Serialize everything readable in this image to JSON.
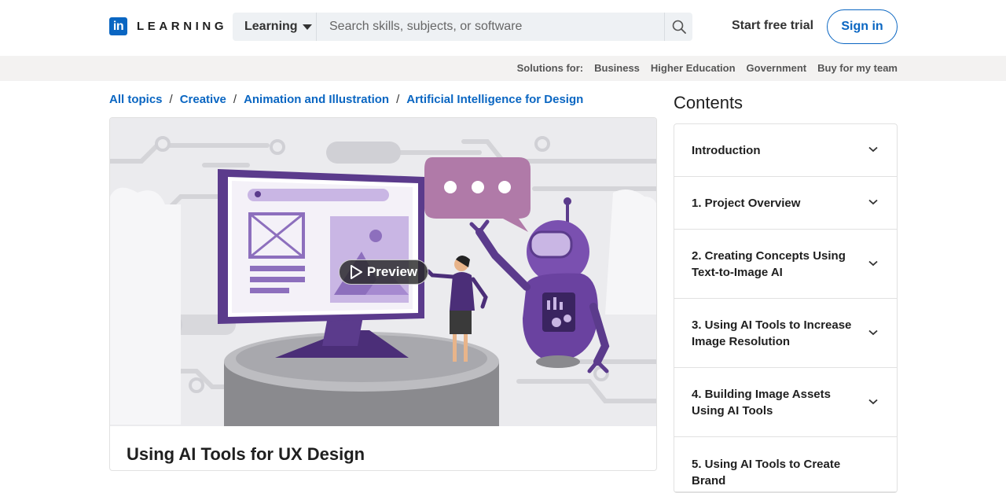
{
  "header": {
    "logo_in": "in",
    "logo_text": "LEARNING",
    "search_scope": "Learning",
    "search_placeholder": "Search skills, subjects, or software",
    "start_trial": "Start free trial",
    "sign_in": "Sign in"
  },
  "solutions": {
    "label": "Solutions for:",
    "links": [
      "Business",
      "Higher Education",
      "Government",
      "Buy for my team"
    ]
  },
  "breadcrumb": [
    "All topics",
    "Creative",
    "Animation and Illustration",
    "Artificial Intelligence for Design"
  ],
  "course": {
    "preview_label": "Preview",
    "title": "Using AI Tools for UX Design"
  },
  "contents": {
    "title": "Contents",
    "items": [
      "Introduction",
      "1. Project Overview",
      "2. Creating Concepts Using Text-to-Image AI",
      "3. Using AI Tools to Increase Image Resolution",
      "4. Building Image Assets Using AI Tools",
      "5. Using AI Tools to Create Brand"
    ]
  },
  "colors": {
    "brand": "#0a66c2",
    "illustration_purple": "#5b3b8c",
    "illustration_light_purple": "#c9b6e4"
  }
}
